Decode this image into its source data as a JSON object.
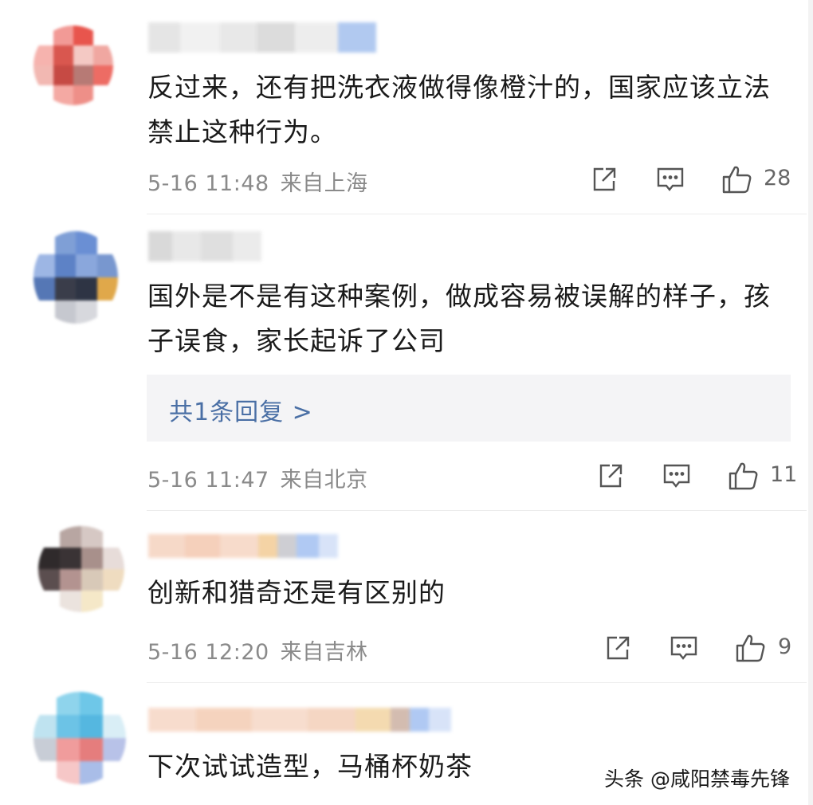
{
  "comments": [
    {
      "text": "反过来，还有把洗衣液做得像橙汁的，国家应该立法禁止这种行为。",
      "date": "5-16 11:48",
      "location": "来自上海",
      "likes": "28",
      "share_icon": "share-icon",
      "reply_icon": "comment-icon",
      "like_icon": "thumbs-up-icon"
    },
    {
      "text": "国外是不是有这种案例，做成容易被误解的样子，孩子误食，家长起诉了公司",
      "reply_summary": "共1条回复 >",
      "date": "5-16 11:47",
      "location": "来自北京",
      "likes": "11",
      "share_icon": "share-icon",
      "reply_icon": "comment-icon",
      "like_icon": "thumbs-up-icon"
    },
    {
      "text": "创新和猎奇还是有区别的",
      "date": "5-16 12:20",
      "location": "来自吉林",
      "likes": "9",
      "share_icon": "share-icon",
      "reply_icon": "comment-icon",
      "like_icon": "thumbs-up-icon"
    },
    {
      "text": "下次试试造型，马桶杯奶茶"
    }
  ],
  "watermark": "头条 @咸阳禁毒先锋",
  "colors": {
    "text": "#1a1a1a",
    "meta": "#8a8a8a",
    "reply_link": "#4a6fa5",
    "reply_bg": "#f4f4f6"
  }
}
